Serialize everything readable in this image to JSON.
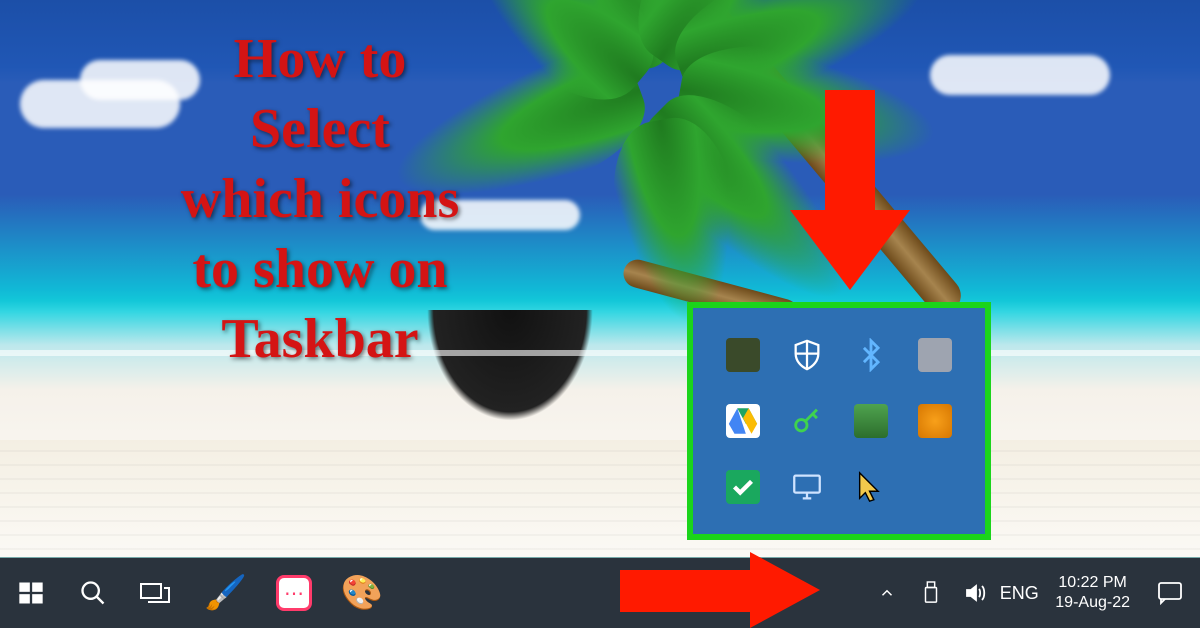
{
  "headline": {
    "line1": "How to",
    "line2": "Select",
    "line3": "which icons",
    "line4": "to show on",
    "line5": "Taskbar"
  },
  "tray_flyout": {
    "icons": [
      {
        "name": "user-account-icon"
      },
      {
        "name": "windows-security-icon"
      },
      {
        "name": "bluetooth-icon"
      },
      {
        "name": "safely-remove-hardware-icon"
      },
      {
        "name": "google-drive-icon"
      },
      {
        "name": "security-key-icon"
      },
      {
        "name": "antivirus-shield-icon"
      },
      {
        "name": "disc-burner-icon"
      },
      {
        "name": "cloud-sync-icon"
      },
      {
        "name": "remote-display-icon"
      },
      {
        "name": "mouse-cursor-icon"
      }
    ]
  },
  "taskbar": {
    "left": {
      "start_name": "start-button",
      "search_name": "search-button",
      "taskview_name": "task-view-button"
    },
    "pinned": [
      {
        "name": "pencil-app",
        "glyph": "🖌️"
      },
      {
        "name": "recorder-app",
        "glyph": "⏺"
      },
      {
        "name": "paint-app",
        "glyph": "🎨"
      }
    ],
    "systray": {
      "chevron_name": "tray-overflow-chevron-icon",
      "usb_name": "usb-device-icon",
      "volume_name": "volume-icon",
      "language": "ENG",
      "clock": {
        "time": "10:22 PM",
        "date": "19-Aug-22"
      },
      "action_center_name": "action-center-icon"
    }
  },
  "arrows": {
    "down_name": "annotation-arrow-down",
    "right_name": "annotation-arrow-right"
  },
  "highlight_box": {
    "name": "tray-flyout-highlight"
  },
  "colors": {
    "headline": "#d41414",
    "arrow": "#ff1a00",
    "highlight_border": "#1bd41b",
    "flyout_bg": "#2d6fb3",
    "taskbar_bg": "#2a333d"
  }
}
